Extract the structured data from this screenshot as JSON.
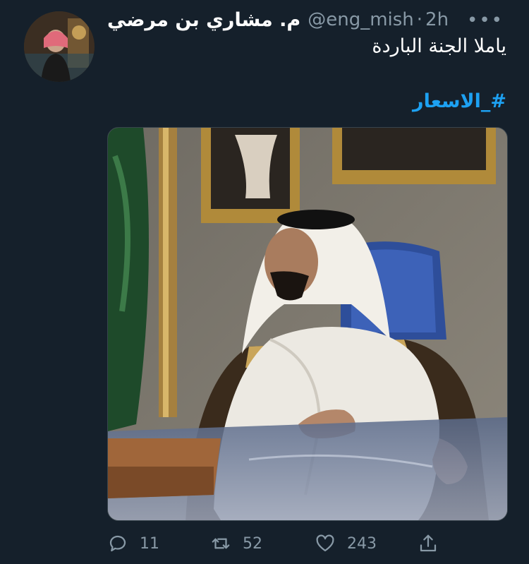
{
  "tweet": {
    "author_name": "م. مشاري بن مرضي",
    "handle": "@eng_mish",
    "separator": "·",
    "time": "2h",
    "text": "ياملا الجنة الباردة",
    "hashtag": "#_الاسعار"
  },
  "actions": {
    "reply_count": "11",
    "retweet_count": "52",
    "like_count": "243"
  },
  "icons": {
    "more": "more-horizontal-icon",
    "reply": "reply-icon",
    "retweet": "retweet-icon",
    "like": "heart-icon",
    "share": "share-icon"
  },
  "colors": {
    "background": "#15202b",
    "secondary_text": "#8899a6",
    "link": "#1da1f2",
    "border": "#38444d"
  }
}
